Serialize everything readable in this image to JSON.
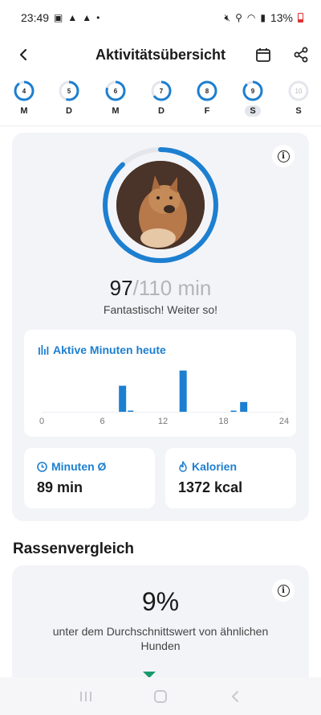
{
  "status_bar": {
    "time": "23:49",
    "battery": "13%"
  },
  "header": {
    "title": "Aktivitätsübersicht"
  },
  "days": [
    {
      "num": "4",
      "label": "M",
      "progress": 0.9,
      "selected": false,
      "future": false
    },
    {
      "num": "5",
      "label": "D",
      "progress": 0.55,
      "selected": false,
      "future": false
    },
    {
      "num": "6",
      "label": "M",
      "progress": 0.8,
      "selected": false,
      "future": false
    },
    {
      "num": "7",
      "label": "D",
      "progress": 0.65,
      "selected": false,
      "future": false
    },
    {
      "num": "8",
      "label": "F",
      "progress": 1.0,
      "selected": false,
      "future": false
    },
    {
      "num": "9",
      "label": "S",
      "progress": 0.88,
      "selected": true,
      "future": false
    },
    {
      "num": "10",
      "label": "S",
      "progress": 0,
      "selected": false,
      "future": true
    }
  ],
  "activity": {
    "minutes_value": "97",
    "minutes_goal": "/110 min",
    "progress": 0.88,
    "praise": "Fantastisch! Weiter so!"
  },
  "chart": {
    "title": "Aktive Minuten heute",
    "chart_data": {
      "type": "bar",
      "x_ticks": [
        "0",
        "6",
        "12",
        "18",
        "24"
      ],
      "xlim": [
        0,
        24
      ],
      "bars": [
        {
          "hour": 8,
          "value": 24
        },
        {
          "hour": 8.8,
          "value": 1
        },
        {
          "hour": 14,
          "value": 38
        },
        {
          "hour": 19,
          "value": 1
        },
        {
          "hour": 20,
          "value": 9
        }
      ],
      "ylim": [
        0,
        40
      ],
      "color": "#1d7fd0"
    }
  },
  "stats": {
    "minutes_label": "Minuten Ø",
    "minutes_value": "89 min",
    "calories_label": "Kalorien",
    "calories_value": "1372 kcal"
  },
  "comparison": {
    "title": "Rassenvergleich",
    "percent": "9%",
    "text": "unter dem Durchschnittswert von ähnlichen Hunden"
  },
  "colors": {
    "accent": "#1d7fd0",
    "ring_track": "#e4e6ec",
    "marker": "#1a9a6c"
  }
}
